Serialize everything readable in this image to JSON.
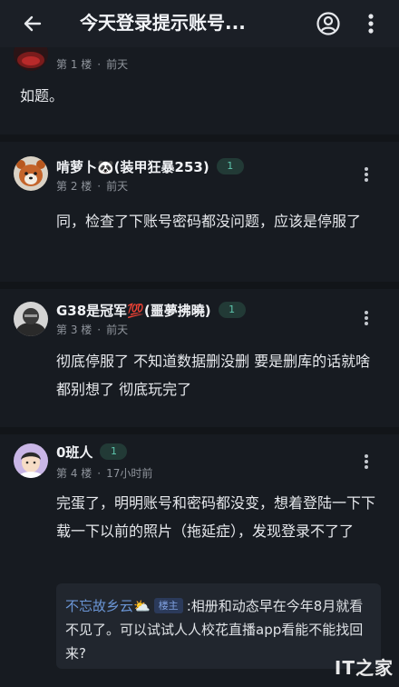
{
  "topbar": {
    "title": "今天登录提示账号...",
    "back_icon": "arrow-left-icon",
    "profile_icon": "user-circle-icon",
    "more_icon": "more-vertical-icon"
  },
  "posts": [
    {
      "floor": "第 1 楼",
      "time": "前天",
      "body": "如题。"
    },
    {
      "username": "啃萝卜🐼(装甲狂暴253)",
      "level": "1",
      "floor": "第 2 楼",
      "time": "前天",
      "body": "同，检查了下账号密码都没问题，应该是停服了"
    },
    {
      "username": "G38是冠军💯(噩夢拂曉)",
      "level": "1",
      "floor": "第 3 楼",
      "time": "前天",
      "body": "彻底停服了 不知道数据删没删 要是删库的话就啥都别想了 彻底玩完了"
    },
    {
      "username": "0班人",
      "level": "1",
      "floor": "第 4 楼",
      "time": "17小时前",
      "body": "完蛋了，明明账号和密码都没变，想着登陆一下下载一下以前的照片（拖延症），发现登录不了了",
      "reply": {
        "name": "不忘故乡云⛅",
        "badge": "楼主",
        "text": ":相册和动态早在今年8月就看不见了。可以试试人人校花直播app看能不能找回来?"
      }
    }
  ],
  "watermark": "IT之家",
  "colors": {
    "background": "#171b21",
    "level_badge_text": "#5ec6ad",
    "reply_name": "#6b96d6"
  }
}
